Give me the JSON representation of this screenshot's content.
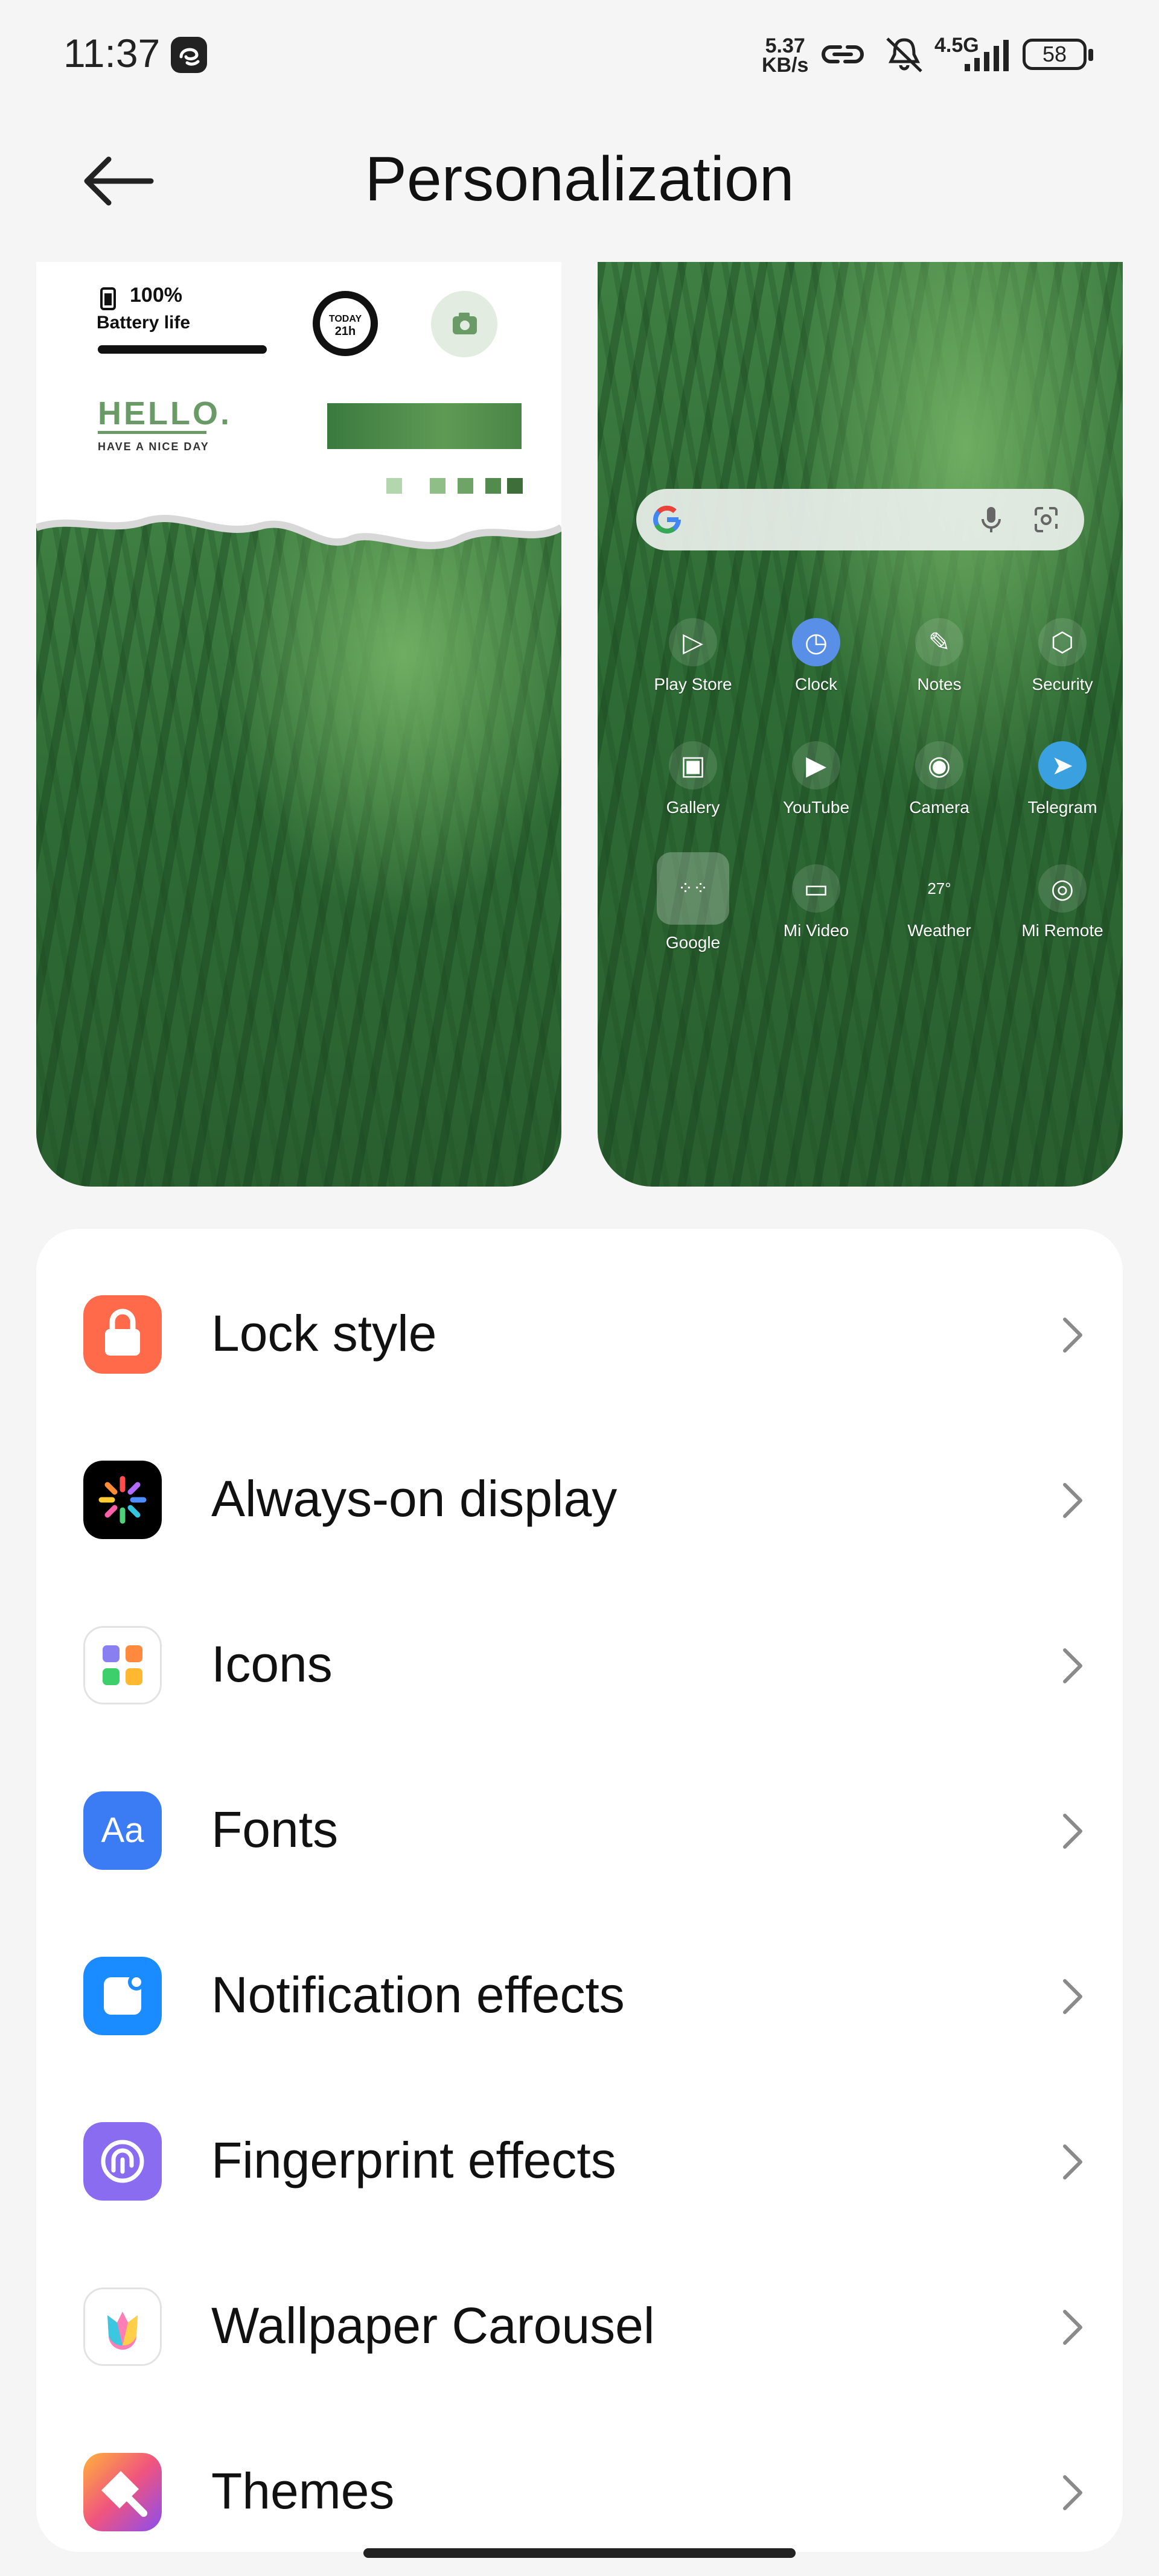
{
  "status_bar": {
    "time": "11:37",
    "net_speed_value": "5.37",
    "net_speed_unit": "KB/s",
    "network": "4.5G",
    "battery": "58"
  },
  "header": {
    "title": "Personalization",
    "back_icon": "arrow-left-icon"
  },
  "lock_preview": {
    "battery_percent": "100%",
    "battery_label": "Battery life",
    "today_label": "TODAY",
    "today_value": "21h",
    "hello": "HELLO.",
    "subtitle": "HAVE A NICE DAY"
  },
  "home_preview": {
    "apps": [
      {
        "label": "Play Store",
        "icon": "play-store-icon"
      },
      {
        "label": "Clock",
        "icon": "clock-icon"
      },
      {
        "label": "Notes",
        "icon": "notes-icon"
      },
      {
        "label": "Security",
        "icon": "security-icon"
      },
      {
        "label": "Gallery",
        "icon": "gallery-icon"
      },
      {
        "label": "YouTube",
        "icon": "youtube-icon"
      },
      {
        "label": "Camera",
        "icon": "camera-icon"
      },
      {
        "label": "Telegram",
        "icon": "telegram-icon"
      },
      {
        "label": "Google",
        "icon": "google-folder-icon"
      },
      {
        "label": "Mi Video",
        "icon": "mi-video-icon"
      },
      {
        "label": "Weather",
        "icon": "weather-icon",
        "value": "27°"
      },
      {
        "label": "Mi Remote",
        "icon": "mi-remote-icon"
      }
    ]
  },
  "menu": {
    "items": [
      {
        "label": "Lock style",
        "icon": "lock-icon",
        "color": "#ff6b4a"
      },
      {
        "label": "Always-on display",
        "icon": "always-on-display-icon",
        "color": "#000000"
      },
      {
        "label": "Icons",
        "icon": "icons-grid-icon",
        "color": "#ffffff"
      },
      {
        "label": "Fonts",
        "icon": "fonts-icon",
        "color": "#3b7cf5"
      },
      {
        "label": "Notification effects",
        "icon": "notification-icon",
        "color": "#1a8cff"
      },
      {
        "label": "Fingerprint effects",
        "icon": "fingerprint-icon",
        "color": "#8a6cf0"
      },
      {
        "label": "Wallpaper Carousel",
        "icon": "wallpaper-carousel-icon",
        "color": "#ffffff"
      },
      {
        "label": "Themes",
        "icon": "themes-icon",
        "color": "#f06a8a"
      }
    ]
  }
}
